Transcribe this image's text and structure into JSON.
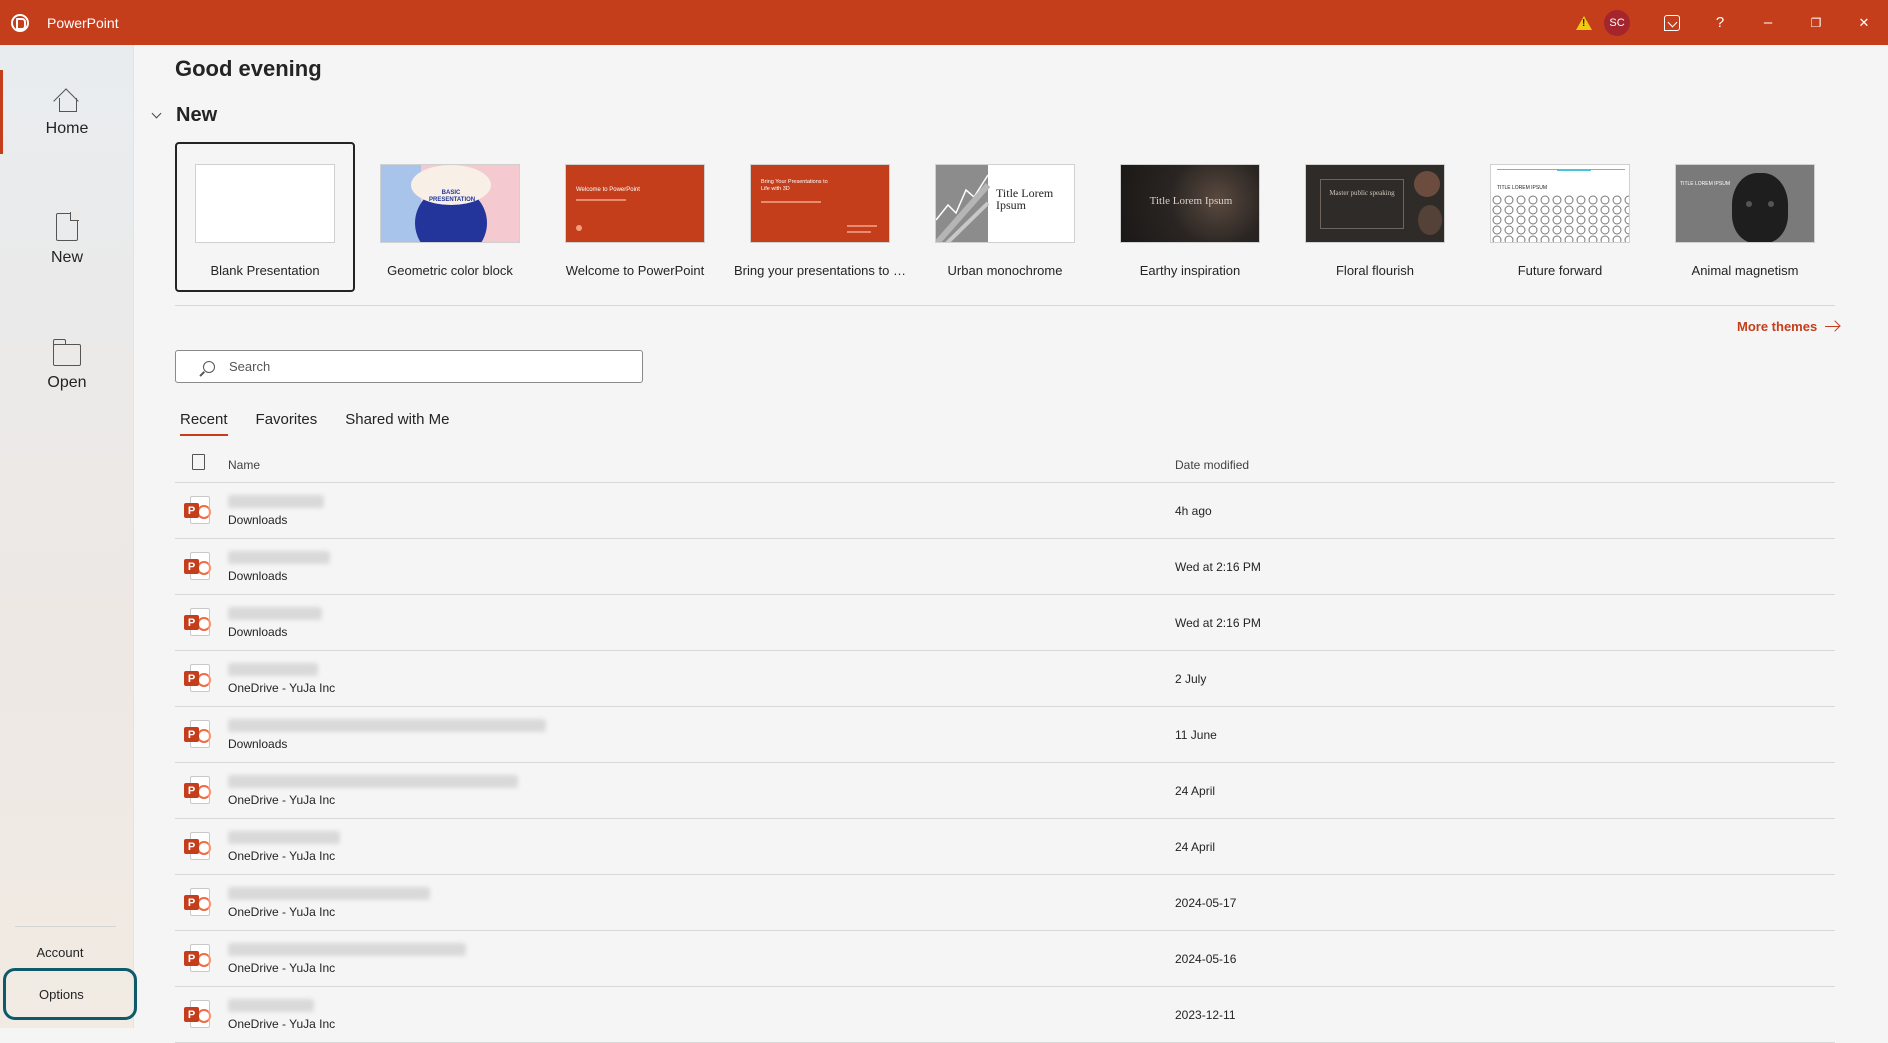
{
  "app": {
    "title": "PowerPoint"
  },
  "titlebar": {
    "avatar_initials": "SC",
    "help": "?",
    "minimize": "–",
    "restore": "❐",
    "close": "✕"
  },
  "sidebar": {
    "items": [
      {
        "label": "Home",
        "icon": "home-icon",
        "active": true
      },
      {
        "label": "New",
        "icon": "document-icon"
      },
      {
        "label": "Open",
        "icon": "folder-icon"
      }
    ],
    "account_label": "Account",
    "options_label": "Options"
  },
  "main": {
    "greeting": "Good evening",
    "new_section_title": "New",
    "more_themes": "More themes",
    "search_placeholder": "Search",
    "tabs": [
      "Recent",
      "Favorites",
      "Shared with Me"
    ],
    "list_headers": {
      "name": "Name",
      "date": "Date modified"
    }
  },
  "templates": [
    {
      "name": "Blank Presentation",
      "selected": true
    },
    {
      "name": "Geometric color block",
      "thumb_text": "BASIC PRESENTATION"
    },
    {
      "name": "Welcome to PowerPoint",
      "thumb_text": "Welcome to PowerPoint"
    },
    {
      "name": "Bring your presentations to li...",
      "thumb_text": "Bring Your Presentations to Life with 3D"
    },
    {
      "name": "Urban monochrome",
      "thumb_text": "Title Lorem Ipsum"
    },
    {
      "name": "Earthy inspiration",
      "thumb_text": "Title Lorem Ipsum"
    },
    {
      "name": "Floral flourish",
      "thumb_text": "Master public speaking"
    },
    {
      "name": "Future forward",
      "thumb_text": "TITLE LOREM IPSUM"
    },
    {
      "name": "Animal magnetism",
      "thumb_text": "TITLE LOREM IPSUM"
    }
  ],
  "recent_files": [
    {
      "location": "Downloads",
      "date": "4h ago"
    },
    {
      "location": "Downloads",
      "date": "Wed at 2:16 PM"
    },
    {
      "location": "Downloads",
      "date": "Wed at 2:16 PM"
    },
    {
      "location": "OneDrive - YuJa Inc",
      "date": "2 July"
    },
    {
      "location": "Downloads",
      "date": "11 June"
    },
    {
      "location": "OneDrive - YuJa Inc",
      "date": "24 April"
    },
    {
      "location": "OneDrive - YuJa Inc",
      "date": "24 April"
    },
    {
      "location": "OneDrive - YuJa Inc",
      "date": "2024-05-17"
    },
    {
      "location": "OneDrive - YuJa Inc",
      "date": "2024-05-16"
    },
    {
      "location": "OneDrive - YuJa Inc",
      "date": "2023-12-11"
    }
  ],
  "colors": {
    "accent": "#c43e1c",
    "focus_ring": "#0e5a6a"
  }
}
